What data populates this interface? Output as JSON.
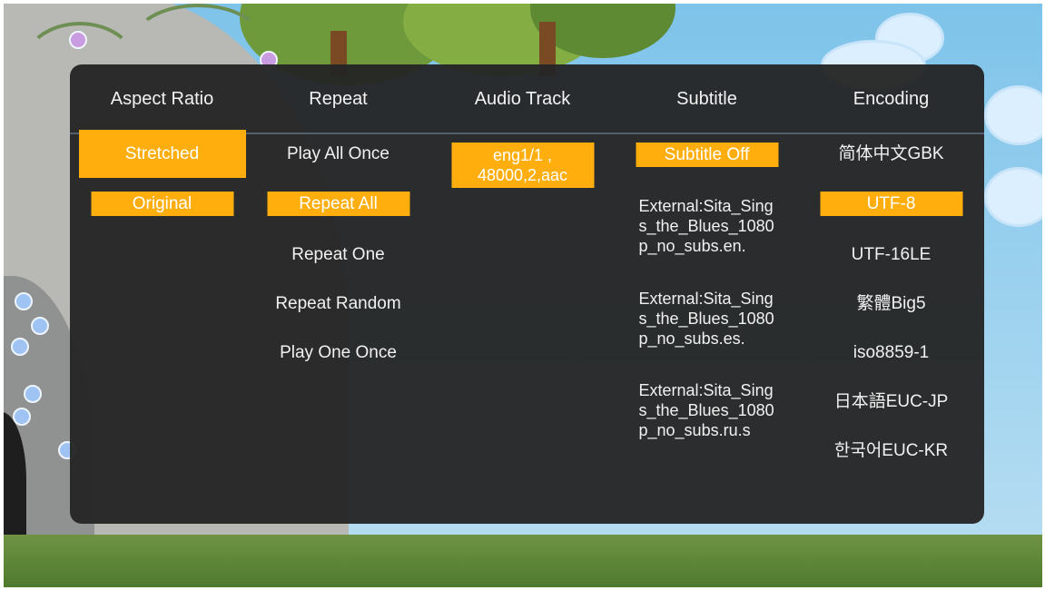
{
  "menu": {
    "headers": {
      "aspect_ratio": "Aspect Ratio",
      "repeat": "Repeat",
      "audio_track": "Audio Track",
      "subtitle": "Subtitle",
      "encoding": "Encoding"
    },
    "aspect_ratio": {
      "selected": "Stretched",
      "items": [
        "Stretched",
        "Original"
      ]
    },
    "repeat": {
      "selected": "Repeat All",
      "items": [
        "Play All Once",
        "Repeat All",
        "Repeat One",
        "Repeat Random",
        "Play One Once"
      ]
    },
    "audio_track": {
      "selected": "eng1/1 , 48000,2,aac",
      "items": [
        "eng1/1 , 48000,2,aac"
      ]
    },
    "subtitle": {
      "selected": "Subtitle Off",
      "items": [
        "Subtitle Off",
        "External:Sita_Sings_the_Blues_1080p_no_subs.en.",
        "External:Sita_Sings_the_Blues_1080p_no_subs.es.",
        "External:Sita_Sings_the_Blues_1080p_no_subs.ru.s"
      ]
    },
    "encoding": {
      "selected": "UTF-8",
      "items": [
        "简体中文GBK",
        "UTF-8",
        "UTF-16LE",
        "繁體Big5",
        "iso8859-1",
        "日本語EUC-JP",
        "한국어EUC-KR"
      ]
    }
  },
  "colors": {
    "accent": "#ffae0d",
    "panel": "#252525",
    "text": "#f1f1f1"
  }
}
